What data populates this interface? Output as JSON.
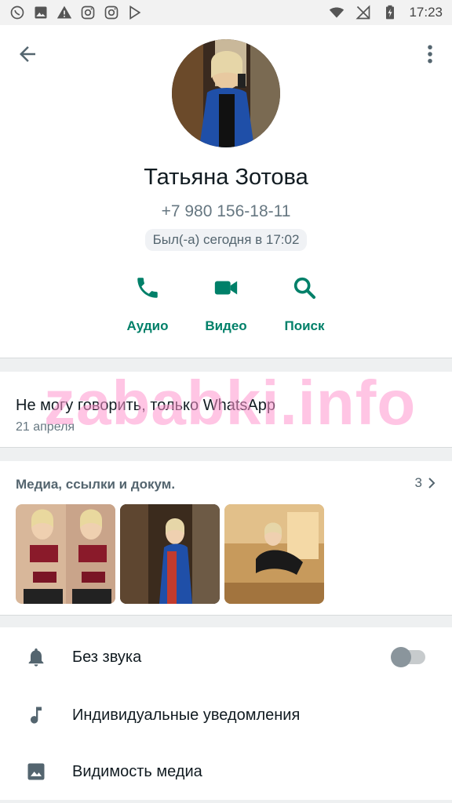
{
  "status_bar": {
    "left_icons": [
      "whatsapp-icon",
      "image-icon",
      "warning-icon",
      "instagram-icon",
      "instagram-icon",
      "play-store-icon"
    ],
    "time": "17:23"
  },
  "contact": {
    "name": "Татьяна Зотова",
    "phone": "+7 980 156-18-11",
    "last_seen": "Был(-а) сегодня в 17:02"
  },
  "actions": [
    {
      "label": "Аудио",
      "icon": "phone-icon"
    },
    {
      "label": "Видео",
      "icon": "video-icon"
    },
    {
      "label": "Поиск",
      "icon": "search-icon"
    }
  ],
  "about": {
    "text": "Не могу говорить, только WhatsApp",
    "date": "21 апреля"
  },
  "media": {
    "title": "Медиа, ссылки и докум.",
    "count": "3"
  },
  "settings": [
    {
      "label": "Без звука",
      "icon": "bell-icon",
      "toggle": false
    },
    {
      "label": "Индивидуальные уведомления",
      "icon": "music-note-icon"
    },
    {
      "label": "Видимость медиа",
      "icon": "image-icon"
    }
  ],
  "watermark": "zababki.info",
  "colors": {
    "accent": "#008069",
    "watermark": "#ff96cd"
  }
}
